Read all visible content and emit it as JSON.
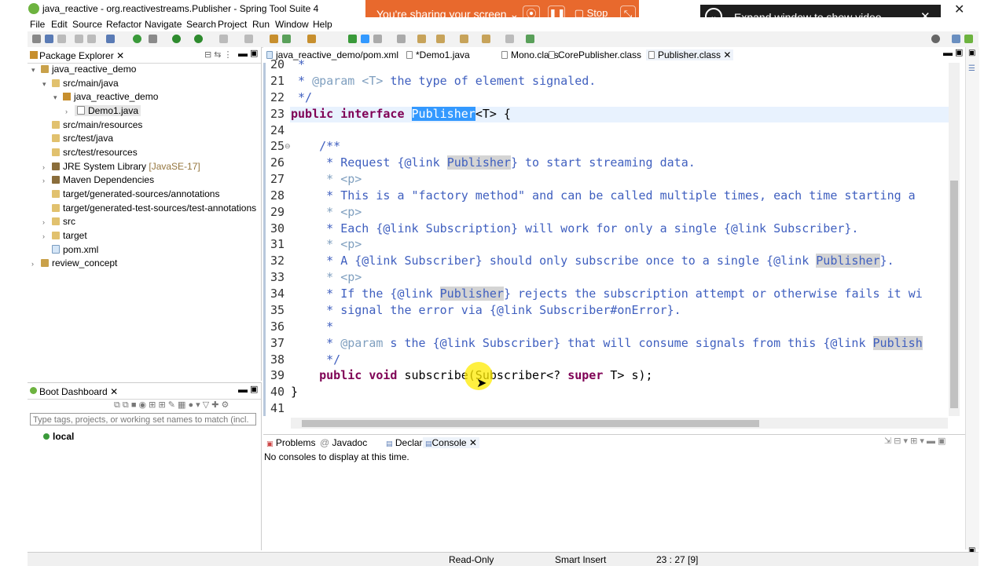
{
  "window": {
    "title": "java_reactive - org.reactivestreams.Publisher - Spring Tool Suite 4"
  },
  "share": {
    "text": "You're sharing your screen",
    "stop_label": "Stop"
  },
  "video": {
    "text": "Expand window to show video"
  },
  "menu": [
    "File",
    "Edit",
    "Source",
    "Refactor",
    "Navigate",
    "Search",
    "Project",
    "Run",
    "Window",
    "Help"
  ],
  "package_explorer": {
    "title": "Package Explorer",
    "items": [
      {
        "label": "java_reactive_demo",
        "twisty": "▾"
      },
      {
        "label": "src/main/java",
        "twisty": "▾"
      },
      {
        "label": "java_reactive_demo",
        "twisty": "▾"
      },
      {
        "label": "Demo1.java",
        "twisty": "›"
      },
      {
        "label": "src/main/resources",
        "twisty": ""
      },
      {
        "label": "src/test/java",
        "twisty": ""
      },
      {
        "label": "src/test/resources",
        "twisty": ""
      },
      {
        "label": "JRE System Library",
        "suffix": "[JavaSE-17]",
        "twisty": "›"
      },
      {
        "label": "Maven Dependencies",
        "twisty": "›"
      },
      {
        "label": "target/generated-sources/annotations",
        "twisty": ""
      },
      {
        "label": "target/generated-test-sources/test-annotations",
        "twisty": ""
      },
      {
        "label": "src",
        "twisty": "›"
      },
      {
        "label": "target",
        "twisty": "›"
      },
      {
        "label": "pom.xml",
        "twisty": ""
      },
      {
        "label": "review_concept",
        "twisty": "›"
      }
    ]
  },
  "boot_dashboard": {
    "title": "Boot Dashboard",
    "filter_placeholder": "Type tags, projects, or working set names to match (incl.",
    "local": "local"
  },
  "editor": {
    "tabs": [
      "java_reactive_demo/pom.xml",
      "*Demo1.java",
      "Mono.class",
      "CorePublisher.class",
      "Publisher.class"
    ],
    "line_numbers": [
      "20",
      "21",
      "22",
      "23",
      "24",
      "25",
      "26",
      "27",
      "28",
      "29",
      "30",
      "31",
      "32",
      "33",
      "34",
      "35",
      "36",
      "37",
      "38",
      "39",
      "40",
      "41"
    ],
    "lines": {
      "l20": " *",
      "l21a": " * ",
      "l21b": "@param",
      "l21c": " <T> ",
      "l21d": "the type of element signaled.",
      "l22": " */",
      "l23a": "public interface ",
      "l23b": "Publisher",
      "l23c": "<T> {",
      "l25": "    /**",
      "l26a": "     * Request {@link ",
      "l26b": "Publisher",
      "l26c": "} to start streaming data.",
      "l27": "     * <p>",
      "l28": "     * This is a \"factory method\" and can be called multiple times, each time starting a",
      "l29": "     * <p>",
      "l30": "     * Each {@link Subscription} will work for only a single {@link Subscriber}.",
      "l31": "     * <p>",
      "l32a": "     * A {@link Subscriber} should only subscribe once to a single {@link ",
      "l32b": "Publisher",
      "l32c": "}.",
      "l33": "     * <p>",
      "l34a": "     * If the {@link ",
      "l34b": "Publisher",
      "l34c": "} rejects the subscription attempt or otherwise fails it wi",
      "l35": "     * signal the error via {@link Subscriber#onError}.",
      "l36": "     *",
      "l37a": "     * ",
      "l37b": "@param",
      "l37c": " s the {@link Subscriber} that will consume signals from this {@link ",
      "l37d": "Publish",
      "l38": "     */",
      "l39a": "    ",
      "l39b": "public void",
      "l39c": " subscribe(Subscriber<? ",
      "l39d": "super",
      "l39e": " T> s);",
      "l40": "}"
    }
  },
  "console": {
    "tabs": [
      "Problems",
      "Javadoc",
      "Declaration",
      "Console"
    ],
    "message": "No consoles to display at this time."
  },
  "status": {
    "mode": "Read-Only",
    "insert": "Smart Insert",
    "position": "23 : 27 [9]"
  }
}
